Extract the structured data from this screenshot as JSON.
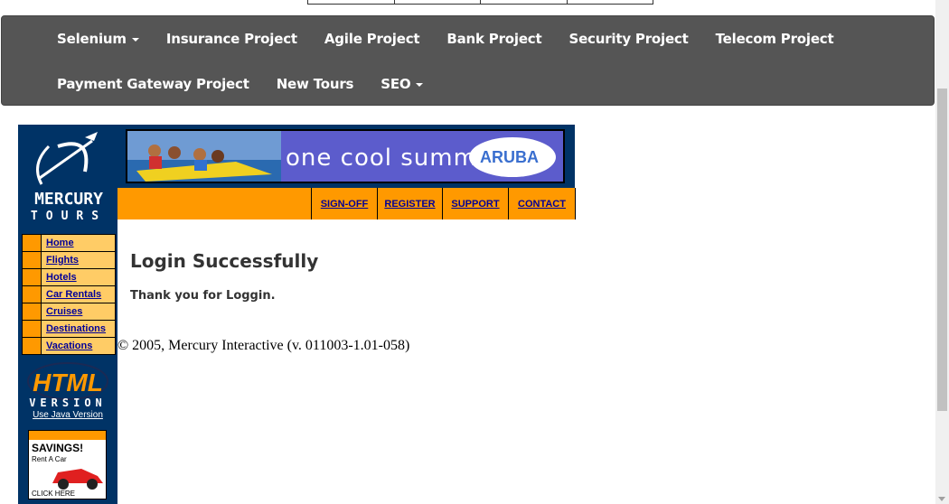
{
  "navbar": {
    "row1": [
      {
        "label": "Selenium",
        "dropdown": true
      },
      {
        "label": "Insurance Project"
      },
      {
        "label": "Agile Project"
      },
      {
        "label": "Bank Project"
      },
      {
        "label": "Security Project"
      },
      {
        "label": "Telecom Project"
      }
    ],
    "row2": [
      {
        "label": "Payment Gateway Project"
      },
      {
        "label": "New Tours"
      },
      {
        "label": "SEO",
        "dropdown": true
      }
    ]
  },
  "logo": {
    "line1": "MERCURY",
    "line2": "TOURS"
  },
  "banner": {
    "text": "one cool summer",
    "badge": "ARUBA"
  },
  "top_links": [
    "SIGN-OFF",
    "REGISTER",
    "SUPPORT",
    "CONTACT"
  ],
  "side_nav": [
    "Home",
    "Flights",
    "Hotels",
    "Car Rentals",
    "Cruises",
    "Destinations",
    "Vacations"
  ],
  "html_version": {
    "line1": "HTML",
    "line2": "VERSION",
    "java_link": "Use Java Version"
  },
  "savings_ad": {
    "title": "SAVINGS!",
    "subtitle": "Rent A Car",
    "cta": "CLICK HERE"
  },
  "content": {
    "title": "Login Successfully",
    "message": "Thank you for Loggin.",
    "copyright": "© 2005, Mercury Interactive (v. 011003-1.01-058)"
  },
  "colors": {
    "navbar": "#555555",
    "mercury_blue": "#003366",
    "orange": "#ff9900",
    "link": "#000099",
    "banner": "#5c5ccc"
  }
}
